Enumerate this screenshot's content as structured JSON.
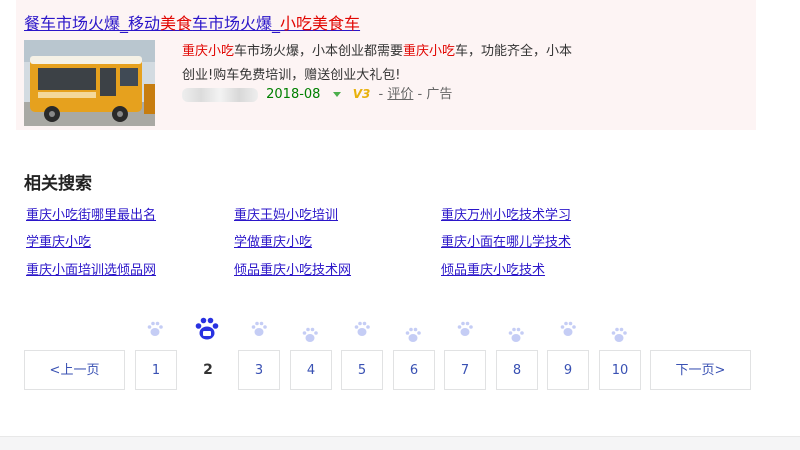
{
  "ad": {
    "title_parts": [
      "餐车市场火爆_移动",
      "美食",
      "车市场火爆_",
      "小吃美食车"
    ],
    "desc_line1_parts": [
      "重庆小吃",
      "车市场火爆，小本创业都需要",
      "重庆小吃",
      "车，功能齐全，小本"
    ],
    "desc_line2": "创业!购车免费培训，赠送创业大礼包!",
    "date": "2018-08",
    "v_badge": "V3",
    "review": "评价",
    "separator": "-",
    "label": "广告"
  },
  "related": {
    "title": "相关搜索",
    "links": [
      "重庆小吃街哪里最出名",
      "重庆王妈小吃培训",
      "重庆万州小吃技术学习",
      "学重庆小吃",
      "学做重庆小吃",
      "重庆小面在哪儿学技术",
      "重庆小面培训选倾品网",
      "倾品重庆小吃技术网",
      "倾品重庆小吃技术"
    ]
  },
  "pager": {
    "prev": "<上一页",
    "pages": [
      "1",
      "2",
      "3",
      "4",
      "5",
      "6",
      "7",
      "8",
      "9",
      "10"
    ],
    "current": "2",
    "next": "下一页>"
  },
  "colors": {
    "link": "#2b16c9",
    "highlight": "#e10602",
    "date": "#008000",
    "pager_text": "#3951b3",
    "paw_active": "#2932e1",
    "paw_inactive": "#c5cdf5"
  }
}
